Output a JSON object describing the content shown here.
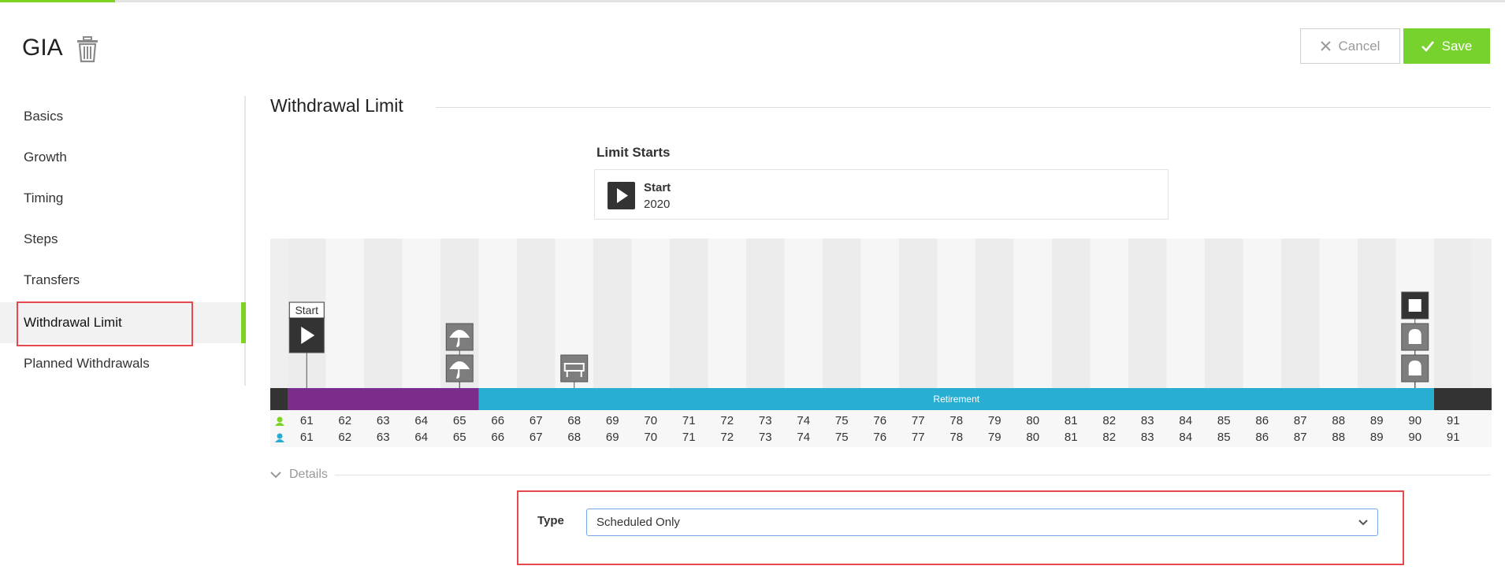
{
  "header": {
    "title": "GIA",
    "cancel_label": "Cancel",
    "save_label": "Save"
  },
  "sidebar": {
    "items": [
      {
        "label": "Basics"
      },
      {
        "label": "Growth"
      },
      {
        "label": "Timing"
      },
      {
        "label": "Steps"
      },
      {
        "label": "Transfers"
      },
      {
        "label": "Withdrawal Limit",
        "active": true
      },
      {
        "label": "Planned Withdrawals"
      }
    ]
  },
  "section": {
    "title": "Withdrawal Limit",
    "limit_starts": {
      "label": "Limit Starts",
      "name": "Start",
      "year": "2020"
    }
  },
  "timeline": {
    "ages_person1": [
      61,
      62,
      63,
      64,
      65,
      66,
      67,
      68,
      69,
      70,
      71,
      72,
      73,
      74,
      75,
      76,
      77,
      78,
      79,
      80,
      81,
      82,
      83,
      84,
      85,
      86,
      87,
      88,
      89,
      90,
      91
    ],
    "ages_person2": [
      61,
      62,
      63,
      64,
      65,
      66,
      67,
      68,
      69,
      70,
      71,
      72,
      73,
      74,
      75,
      76,
      77,
      78,
      79,
      80,
      81,
      82,
      83,
      84,
      85,
      86,
      87,
      88,
      89,
      90,
      91
    ],
    "person1_color": "#7ed321",
    "person2_color": "#2aabd2",
    "segments": [
      {
        "from_age": 61,
        "to_age": 65,
        "color": "#7b2d8e",
        "label": ""
      },
      {
        "from_age": 66,
        "to_age": 90,
        "color": "#29aed3",
        "label": "Retirement"
      }
    ],
    "events": [
      {
        "age": 61,
        "icon": "play-icon",
        "label": "Start"
      },
      {
        "age": 65,
        "icon": "umbrella-icon",
        "label": ""
      },
      {
        "age": 65,
        "icon": "umbrella-icon",
        "label": ""
      },
      {
        "age": 68,
        "icon": "roadblock-icon",
        "label": ""
      },
      {
        "age": 90,
        "icon": "stop-icon",
        "label": ""
      },
      {
        "age": 90,
        "icon": "headstone-icon",
        "label": ""
      },
      {
        "age": 90,
        "icon": "headstone-icon",
        "label": ""
      }
    ]
  },
  "details": {
    "label": "Details",
    "type_label": "Type",
    "type_value": "Scheduled Only"
  },
  "colors": {
    "accent_green": "#7ed321",
    "highlight_red": "#e5484d",
    "dark": "#333333"
  }
}
